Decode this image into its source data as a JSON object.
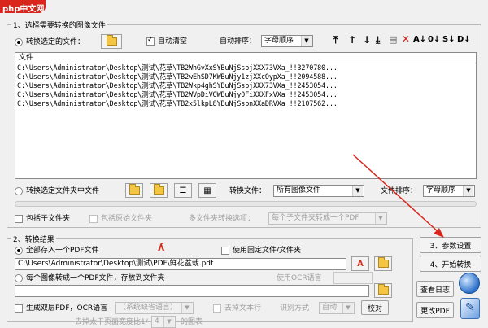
{
  "watermark": "php中文网",
  "section1": {
    "title": "1、选择需要转换的图像文件",
    "convert_files_label": "转换选定的文件：",
    "auto_clear_label": "自动清空",
    "auto_sort_label": "自动排序：",
    "auto_sort_value": "字母顺序",
    "list_header": "文件",
    "files": [
      "C:\\Users\\Administrator\\Desktop\\测试\\花草\\TB2WhGvXxSYBuNjSspjXXX73VXa_!!3270780...",
      "C:\\Users\\Administrator\\Desktop\\测试\\花草\\TB2wEhSD7KWBuNjy1zjXXcOypXa_!!2094588...",
      "C:\\Users\\Administrator\\Desktop\\测试\\花草\\TB2Wkp4ghSYBuNjSspjXXX73VXa_!!2453054...",
      "C:\\Users\\Administrator\\Desktop\\测试\\花草\\TB2WVpDiVOWBuNjy0FiXXXFxVXa_!!2453054...",
      "C:\\Users\\Administrator\\Desktop\\测试\\花草\\TB2x5lkpL8YBuNjSspnXXaDRVXa_!!2107562..."
    ],
    "convert_folder_label": "转换选定文件夹中文件",
    "convert_file_type_label": "转换文件：",
    "convert_file_type_value": "所有图像文件",
    "file_sort_label": "文件排序：",
    "file_sort_value": "字母顺序",
    "include_subfolders_label": "包括子文件夹",
    "include_only_folders_label": "包括原始文件夹",
    "multi_folder_label": "多文件夹转换选项：",
    "multi_folder_value": "每个子文件夹转成一个PDF"
  },
  "section2": {
    "title": "2、转换结果",
    "all_in_one_label": "全部存入一个PDF文件",
    "fixed_name_label": "使用固定文件/文件夹",
    "output_path": "C:\\Users\\Administrator\\Desktop\\测试\\PDF\\鲜花盆栽.pdf",
    "each_image_label": "每个图像转成一个PDF文件，存放到文件夹",
    "ocr_lang_label": "生成双层PDF，OCR语言",
    "ocr_lang_value": "（系统缺省语言）",
    "ocr_engine_label": "去掉文本行",
    "ocr_method_label": "识别方式",
    "ocr_method_value": "自动",
    "calibrate_label": "校对",
    "ocr_hint": "使用OCR语言",
    "page_limit_label": "去掉太干页面宽度比1/",
    "page_limit_value": "4",
    "page_limit_suffix": "的图表"
  },
  "buttons": {
    "settings": "3、参数设置",
    "start": "4、开始转换",
    "view_log": "查看日志",
    "edit_pdf": "更改PDF"
  }
}
